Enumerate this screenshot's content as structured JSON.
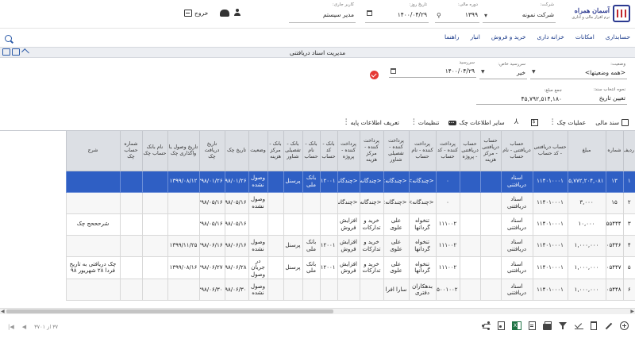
{
  "logo": {
    "title": "آسمان همراه",
    "tagline": "نرم افزار مالی و اداری"
  },
  "header": {
    "company_label": "شرکت:",
    "company_value": "شرکت نمونه",
    "fiscal_label": "دوره مالی:",
    "fiscal_value": "۱۳۹۹",
    "date_label": "تاریخ روز:",
    "date_value": "۱۴۰۰/۰۴/۲۹",
    "user_label": "کاربر جاری:",
    "user_value": "مدیر سیستم",
    "logout_label": "خروج"
  },
  "menu": [
    "حسابداری",
    "امکانات",
    "خزانه داری",
    "خرید و فروش",
    "انبار",
    "راهنما"
  ],
  "page_title": "مدیریت اسناد دریافتنی",
  "filters": {
    "status_label": "وضعیت:",
    "status_value": "<همه وضعیتها>",
    "special_due_label": "سررسید خاص:",
    "special_due_value": "خیر",
    "due_label": "سررسید",
    "due_value": "۱۴۰۰/۰۴/۲۹",
    "date_select_label": "نحوه انتخاب سند:",
    "date_select_value": "تعیین تاریخ",
    "sum_label": "جمع مبلغ:",
    "sum_value": "۴۵,۷۹۲,۵۱۴,۱۸۰"
  },
  "toolbar": {
    "voucher": "سند مالی",
    "check_ops": "عملیات چک",
    "other_info": "سایر اطلاعات چک",
    "settings": "تنظیمات",
    "base_info": "تعریف اطلاعات پایه"
  },
  "table": {
    "columns": [
      "ردیف",
      "شماره",
      "مبلغ",
      "حساب دریافتنی - کد حساب",
      "حساب دریافتنی - نام حساب",
      "حساب دریافتنی - مرکز هزینه",
      "حساب دریافتنی - پروژه",
      "پرداخت کننده - کد حساب",
      "پرداخت کننده - نام حساب",
      "پرداخت کننده - تفصیلی شناور",
      "پرداخت کننده - مرکز هزینه",
      "پرداخت کننده - پروژه",
      "بانک - کد حساب",
      "بانک - نام حساب",
      "بانک - تفصیلی شناور",
      "بانک - مرکز هزینه",
      "وضعیت",
      "تاریخ چک",
      "تاریخ دریافت چک",
      "تاریخ وصول یا واگذاری چک",
      "نام بانک حساب چک",
      "شماره حساب چک",
      "شرح"
    ],
    "rows": [
      [
        "۱",
        "۱۳",
        "۴۵,۷۷۲,۲۰۴,۰۸۱",
        "۱۱۴۰۱۰۰۰۱",
        "اسناد دریافتنی",
        "",
        "",
        "۰",
        "<چندگانه>",
        "<چندگانه>",
        "<چندگانه>",
        "<چندگانه>",
        "۱۱۲۰۰۱",
        "بانک ملی",
        "پرسنل",
        "",
        "وصول نشده",
        "۱۳۹۸/۰۱/۲۶",
        "۱۳۹۸/۰۱/۲۶",
        "۱۳۹۹/۰۸/۱۲",
        "",
        "",
        ""
      ],
      [
        "۲",
        "۱۵",
        "۳,۰۰۰",
        "۱۱۴۰۱۰۰۰۱",
        "اسناد دریافتنی",
        "",
        "",
        "۰",
        "<چندگانه>",
        "<چندگانه>",
        "<چندگانه>",
        "<چندگانه>",
        "",
        "",
        "",
        "",
        "وصول نشده",
        "۱۳۹۸/۰۵/۱۶",
        "۱۳۹۸/۰۵/۱۶",
        "",
        "",
        "",
        ""
      ],
      [
        "۳",
        "۱۵,۵۵۵۵۴۴۴",
        "۱۰,۰۰۰",
        "۱۱۴۰۱۰۰۰۱",
        "اسناد دریافتنی",
        "",
        "",
        "۱۱۱۰۰۲",
        "تنخواه گردانها",
        "علی علوی",
        "خرید و تدارکات",
        "افزایش فروش",
        "",
        "",
        "",
        "",
        "",
        "۱۳۹۸/۰۵/۱۶",
        "۱۳۹۸/۰۵/۱۶",
        "",
        "",
        "",
        "شرحححح چک"
      ],
      [
        "۴",
        "۱,۰۰۰,۰۰۰۵۴۴۶",
        "۱,۰۰۰,۰۰۰",
        "۱۱۴۰۱۰۰۰۱",
        "اسناد دریافتنی",
        "",
        "",
        "۱۱۱۰۰۲",
        "تنخواه گردانها",
        "علی علوی",
        "خرید و تدارکات",
        "افزایش فروش",
        "۱۱۲۰۰۱",
        "بانک ملی",
        "پرسنل",
        "",
        "وصول نشده",
        "۱۳۹۸/۰۶/۱۶",
        "۱۳۹۸/۰۶/۱۶",
        "۱۳۹۹/۱۱/۲۵",
        "",
        "",
        ""
      ],
      [
        "۵",
        "۱,۰۰۰,۰۰۰۵۴۴۷",
        "۱,۰۰۰,۰۰۰",
        "۱۱۴۰۱۰۰۰۱",
        "اسناد دریافتنی",
        "",
        "",
        "۱۱۱۰۰۲",
        "تنخواه گردانها",
        "علی علوی",
        "خرید و تدارکات",
        "افزایش فروش",
        "۱۱۲۰۰۱",
        "بانک ملی",
        "پرسنل",
        "",
        "در جریان وصول",
        "۱۳۹۸/۰۶/۲۸",
        "۱۳۹۸/۰۶/۲۷",
        "۱۳۹۹/۰۸/۱۶",
        "",
        "",
        "چک دریافتی به تاریخ فردا ۲۸ شهریور ۹۸"
      ],
      [
        "۶",
        "۱,۰۰۰,۰۰۰۵۴۴۸",
        "۱,۰۰۰,۰۰۰",
        "۱۱۴۰۱۰۰۰۱",
        "اسناد دریافتنی",
        "",
        "",
        "۱۱۵۰۰۱۰۰۲",
        "بدهکاران دفتری",
        "سارا افرا",
        "",
        "",
        "",
        "",
        "",
        "",
        "وصول نشده",
        "۱۳۹۸/۰۶/۳۰",
        "۱۳۹۸/۰۶/۳۰",
        "",
        "",
        "",
        ""
      ]
    ]
  },
  "pager": {
    "page_info": "۳۷ از ۳۷۰۱"
  },
  "colors": {
    "accent": "#2b3990",
    "selected_row": "#2f5fc4",
    "menu_text": "#1a3a8a",
    "red_action": "#e53935"
  }
}
